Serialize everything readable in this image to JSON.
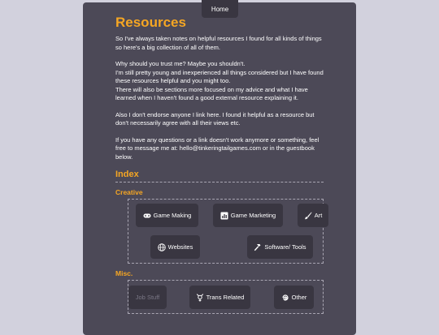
{
  "nav": {
    "home_label": "Home"
  },
  "page": {
    "title": "Resources",
    "intro": [
      [
        "So I've always taken notes on helpful resources I found for all kinds of things so here's a big collection of all of them."
      ],
      [
        "Why should you trust me? Maybe you shouldn't.",
        "I'm still pretty young and inexperienced all things considered but I have found these resources helpful and you might too.",
        "There will also be sections more focused on my advice and what I have learned when I haven't found a good external resource explaining it."
      ],
      [
        "Also I don't endorse anyone I link here. I found it helpful as a resource but don't necessarily agree with all their views etc."
      ],
      [
        "If you have any questions or a link doesn't work anymore or something, feel free to message me at: hello@tinkeringtailgames.com or in the guestbook below."
      ]
    ]
  },
  "index": {
    "heading": "Index",
    "creative": {
      "heading": "Creative",
      "buttons": [
        {
          "label": "Game Making",
          "icon": "gamepad-icon"
        },
        {
          "label": "Game Marketing",
          "icon": "bar-chart-icon"
        },
        {
          "label": "Art",
          "icon": "brush-icon"
        },
        {
          "label": "Websites",
          "icon": "globe-icon"
        },
        {
          "label": "Software/ Tools",
          "icon": "hammer-icon"
        }
      ]
    },
    "misc": {
      "heading": "Misc.",
      "buttons": [
        {
          "label": "Job Stuff",
          "icon": "",
          "disabled": true
        },
        {
          "label": "Trans Related",
          "icon": "transgender-icon"
        },
        {
          "label": "Other",
          "icon": "swirl-icon"
        }
      ]
    }
  },
  "colors": {
    "accent": "#f5a623",
    "panel": "#4c4957",
    "button": "#393641",
    "background": "#d2d1dd"
  }
}
